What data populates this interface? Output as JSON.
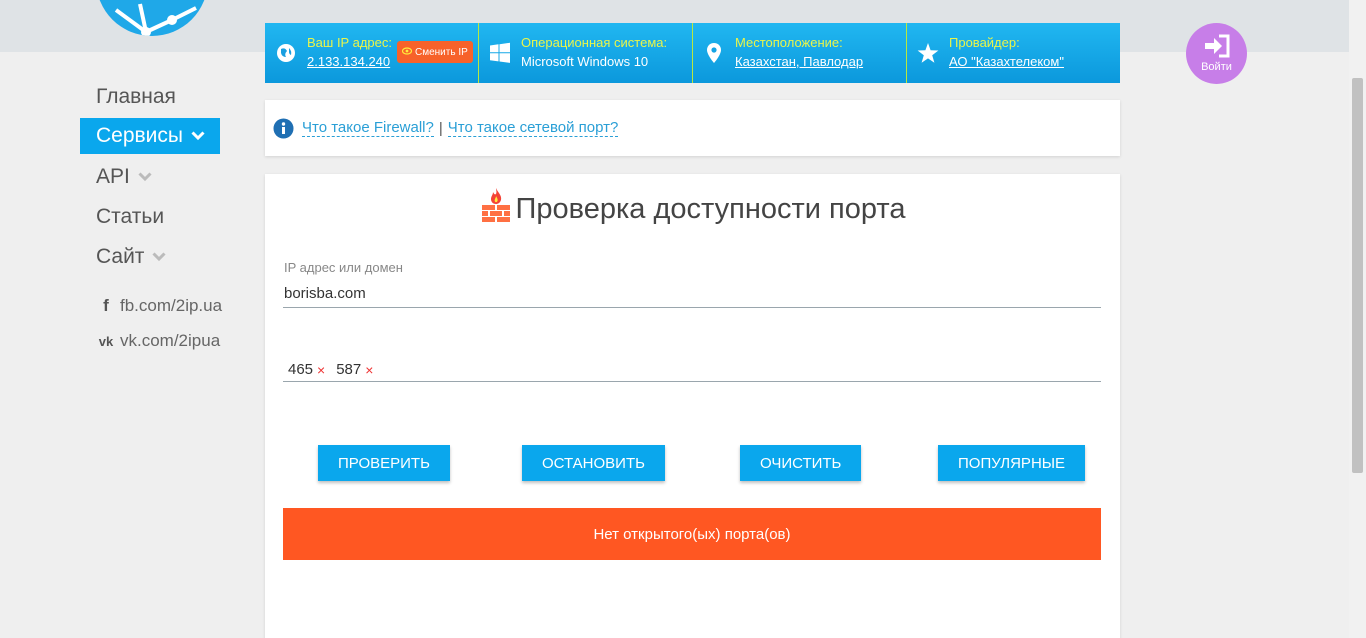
{
  "colors": {
    "accent": "#0aa7ed",
    "info_label": "#e9f54a",
    "result_bg": "#ff5722",
    "login_bg": "#c77ee8",
    "chip_bg": "#f7622a"
  },
  "sidebar": {
    "items": [
      {
        "label": "Главная",
        "active": false,
        "has_chevron": false
      },
      {
        "label": "Сервисы",
        "active": true,
        "has_chevron": true
      },
      {
        "label": "API",
        "active": false,
        "has_chevron": true
      },
      {
        "label": "Статьи",
        "active": false,
        "has_chevron": false
      },
      {
        "label": "Сайт",
        "active": false,
        "has_chevron": true
      }
    ],
    "social": [
      {
        "icon": "facebook-icon",
        "label": "fb.com/2ip.ua"
      },
      {
        "icon": "vk-icon",
        "label": "vk.com/2ipua"
      }
    ]
  },
  "infobar": {
    "ip": {
      "label": "Ваш IP адрес:",
      "value": "2.133.134.240",
      "icon": "globe-icon"
    },
    "change_ip": {
      "label": "Сменить IP",
      "icon": "eye-icon"
    },
    "os": {
      "label": "Операционная система:",
      "value": "Microsoft Windows 10",
      "icon": "windows-icon"
    },
    "location": {
      "label": "Местоположение:",
      "value": "Казахстан, Павлодар",
      "icon": "map-pin-icon"
    },
    "provider": {
      "label": "Провайдер:",
      "value": "АО \"Казахтелеком\"",
      "icon": "star-icon"
    }
  },
  "login": {
    "label": "Войти",
    "icon": "sign-in-icon"
  },
  "help": {
    "icon": "info-icon",
    "link1": "Что такое Firewall?",
    "separator": "|",
    "link2": "Что такое сетевой порт?"
  },
  "main": {
    "title": "Проверка доступности порта",
    "title_icon": "firewall-icon",
    "ip_label": "IP адрес или домен",
    "ip_value": "borisba.com",
    "ports": [
      {
        "value": "465",
        "remove": "×"
      },
      {
        "value": "587",
        "remove": "×"
      }
    ],
    "buttons": {
      "check": "ПРОВЕРИТЬ",
      "stop": "ОСТАНОВИТЬ",
      "clear": "ОЧИСТИТЬ",
      "popular": "ПОПУЛЯРНЫЕ"
    },
    "result": "Нет открытого(ых) порта(ов)"
  }
}
